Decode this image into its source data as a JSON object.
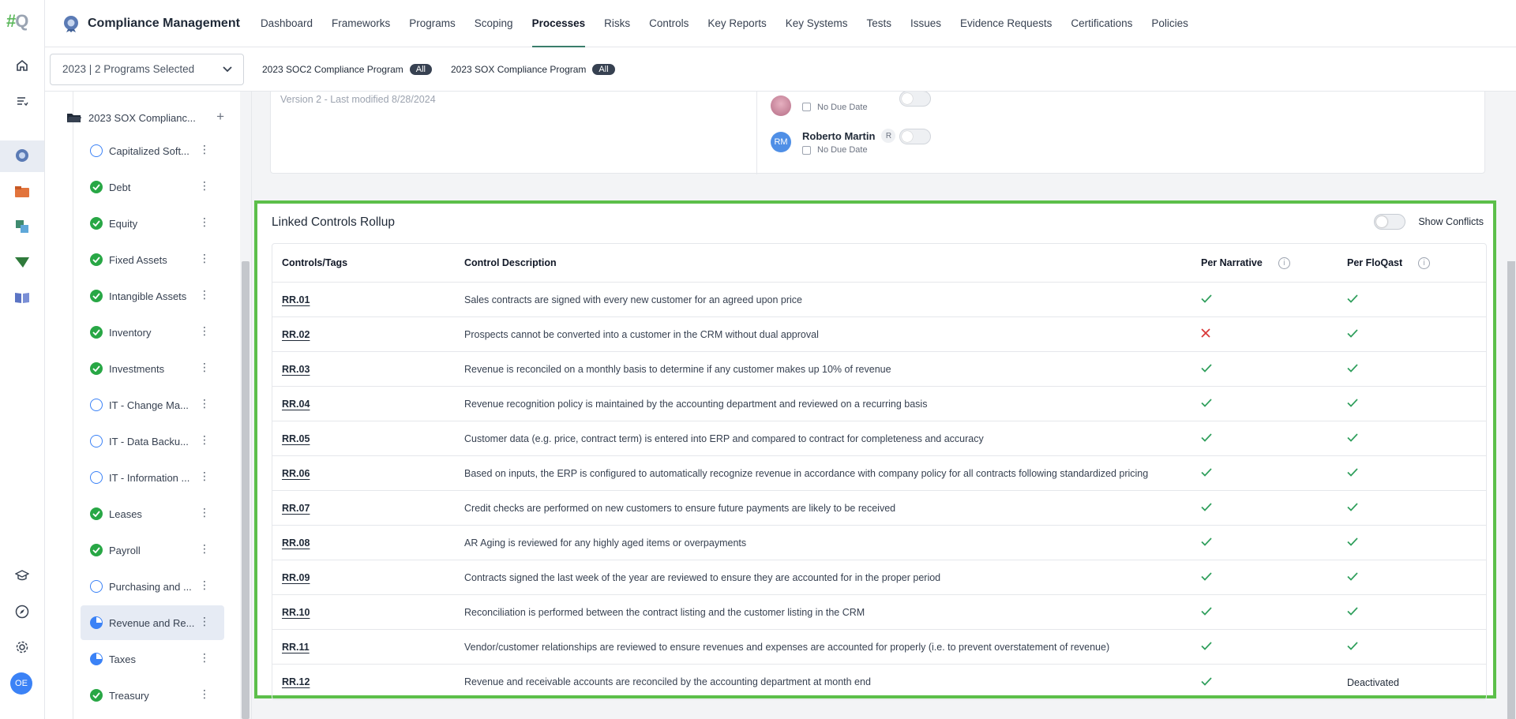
{
  "app": {
    "logo_text": "#FQ",
    "title": "Compliance Management"
  },
  "nav": [
    "Dashboard",
    "Frameworks",
    "Programs",
    "Scoping",
    "Processes",
    "Risks",
    "Controls",
    "Key Reports",
    "Key Systems",
    "Tests",
    "Issues",
    "Evidence Requests",
    "Certifications",
    "Policies"
  ],
  "nav_active": "Processes",
  "filter": {
    "program_select": "2023 | 2 Programs Selected",
    "chips": [
      {
        "label": "2023 SOC2 Compliance Program",
        "pill": "All"
      },
      {
        "label": "2023 SOX Compliance Program",
        "pill": "All"
      }
    ]
  },
  "rail": {
    "icons": [
      "home-icon",
      "list-icon",
      "shield-badge-icon",
      "folder-icon",
      "sync-icon",
      "send-icon",
      "book-icon",
      "graduation-cap-icon",
      "compass-icon",
      "gear-icon"
    ],
    "user_initials": "OE"
  },
  "tree": {
    "folder_label": "2023 SOX Complianc...",
    "items": [
      {
        "label": "Capitalized Soft...",
        "status": "todo"
      },
      {
        "label": "Debt",
        "status": "done"
      },
      {
        "label": "Equity",
        "status": "done"
      },
      {
        "label": "Fixed Assets",
        "status": "done"
      },
      {
        "label": "Intangible Assets",
        "status": "done"
      },
      {
        "label": "Inventory",
        "status": "done"
      },
      {
        "label": "Investments",
        "status": "done"
      },
      {
        "label": "IT - Change Ma...",
        "status": "todo"
      },
      {
        "label": "IT - Data Backu...",
        "status": "todo"
      },
      {
        "label": "IT - Information ...",
        "status": "todo"
      },
      {
        "label": "Leases",
        "status": "done"
      },
      {
        "label": "Payroll",
        "status": "done"
      },
      {
        "label": "Purchasing and ...",
        "status": "todo"
      },
      {
        "label": "Revenue and Re...",
        "status": "partial",
        "selected": true
      },
      {
        "label": "Taxes",
        "status": "partial"
      },
      {
        "label": "Treasury",
        "status": "done"
      }
    ]
  },
  "previous_card": {
    "version_text": "Version 2 - Last modified 8/28/2024",
    "assignees": [
      {
        "name": "",
        "initials": "",
        "due": "No Due Date"
      },
      {
        "name": "Roberto Martin",
        "initials": "RM",
        "role": "R",
        "due": "No Due Date"
      }
    ]
  },
  "rollup": {
    "title": "Linked Controls Rollup",
    "show_conflicts_label": "Show Conflicts",
    "columns": [
      "Controls/Tags",
      "Control Description",
      "Per Narrative",
      "Per FloQast"
    ],
    "rows": [
      {
        "tag": "RR.01",
        "desc": "Sales contracts are signed with every new customer for an agreed upon price",
        "narrative": "check",
        "floqast": "check"
      },
      {
        "tag": "RR.02",
        "desc": "Prospects cannot be converted into a customer in the CRM without dual approval",
        "narrative": "cross",
        "floqast": "check"
      },
      {
        "tag": "RR.03",
        "desc": "Revenue is reconciled on a monthly basis to determine if any customer makes up 10% of revenue",
        "narrative": "check",
        "floqast": "check"
      },
      {
        "tag": "RR.04",
        "desc": "Revenue recognition policy is maintained by the accounting department and reviewed on a recurring basis",
        "narrative": "check",
        "floqast": "check"
      },
      {
        "tag": "RR.05",
        "desc": "Customer data (e.g. price, contract term) is entered into ERP and compared to contract for completeness and accuracy",
        "narrative": "check",
        "floqast": "check"
      },
      {
        "tag": "RR.06",
        "desc": "Based on inputs, the ERP is configured to automatically recognize revenue in accordance with company policy for all contracts following standardized pricing",
        "narrative": "check",
        "floqast": "check"
      },
      {
        "tag": "RR.07",
        "desc": "Credit checks are performed on new customers to ensure future payments are likely to be received",
        "narrative": "check",
        "floqast": "check"
      },
      {
        "tag": "RR.08",
        "desc": "AR Aging is reviewed for any highly aged items or overpayments",
        "narrative": "check",
        "floqast": "check"
      },
      {
        "tag": "RR.09",
        "desc": "Contracts signed the last week of the year are reviewed to ensure they are accounted for in the proper period",
        "narrative": "check",
        "floqast": "check"
      },
      {
        "tag": "RR.10",
        "desc": "Reconciliation is performed between the contract listing and the customer listing in the CRM",
        "narrative": "check",
        "floqast": "check"
      },
      {
        "tag": "RR.11",
        "desc": "Vendor/customer relationships are reviewed to ensure revenues and expenses are accounted for properly (i.e. to prevent overstatement of revenue)",
        "narrative": "check",
        "floqast": "check"
      },
      {
        "tag": "RR.12",
        "desc": "Revenue and receivable accounts are reconciled by the accounting department at month end",
        "narrative": "check",
        "floqast": "Deactivated"
      }
    ]
  },
  "colors": {
    "check": "#2e9e5b",
    "cross": "#d93636",
    "highlight_border": "#5cbf4a",
    "status_done": "#28a745",
    "status_todo": "#3b82f6"
  }
}
